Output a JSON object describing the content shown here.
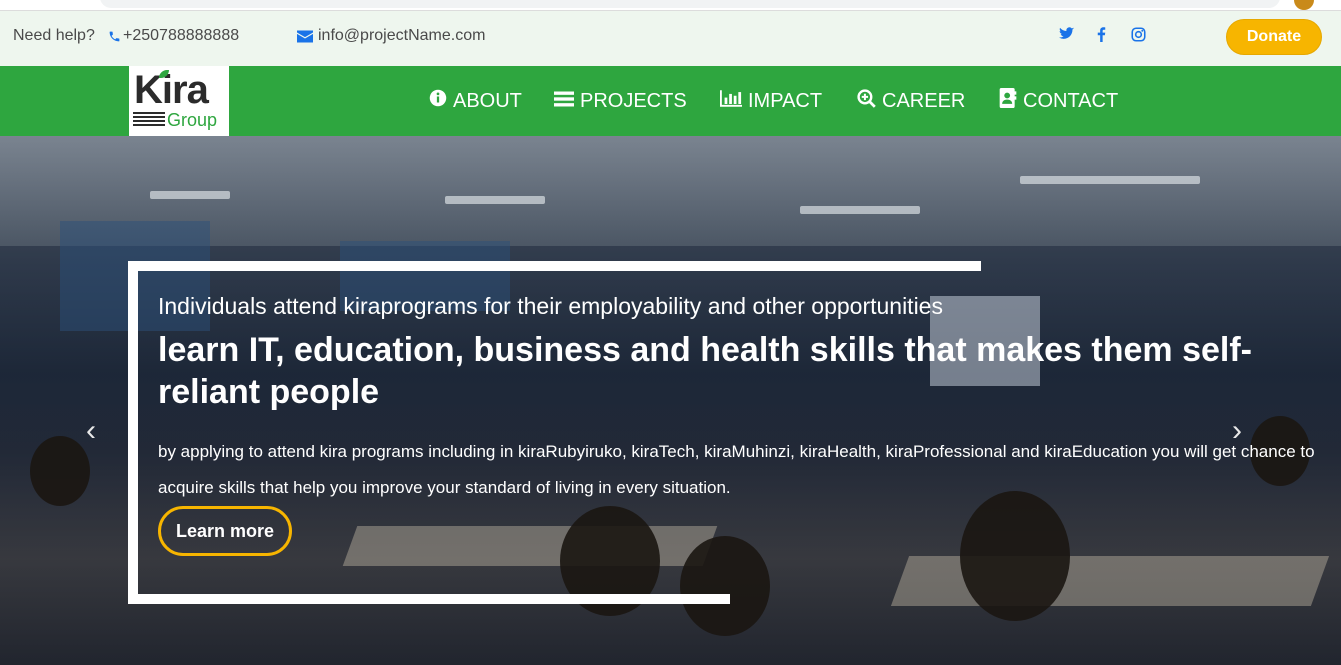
{
  "topbar": {
    "help_label": "Need help?",
    "phone": "+250788888888",
    "email": "info@projectName.com",
    "donate_label": "Donate"
  },
  "nav": {
    "logo_text": "Kira",
    "logo_sub": "Group",
    "items": [
      {
        "label": "ABOUT",
        "icon": "info-circle-icon"
      },
      {
        "label": "PROJECTS",
        "icon": "list-icon"
      },
      {
        "label": "IMPACT",
        "icon": "bar-chart-icon"
      },
      {
        "label": "CAREER",
        "icon": "search-plus-icon"
      },
      {
        "label": "CONTACT",
        "icon": "contact-card-icon"
      }
    ]
  },
  "hero": {
    "subtitle": "Individuals attend kiraprograms for their employability and other opportunities",
    "title": "learn IT, education, business and health skills that makes them self-reliant people",
    "description": "by applying to attend kira programs including in kiraRubyiruko, kiraTech, kiraMuhinzi, kiraHealth, kiraProfessional and kiraEducation you will get chance to acquire skills that help you improve your standard of living in every situation.",
    "button_label": "Learn more",
    "prev_arrow": "‹",
    "next_arrow": "›"
  },
  "colors": {
    "green": "#2ea63f",
    "donate": "#f7b500",
    "link_blue": "#1a73e8"
  }
}
